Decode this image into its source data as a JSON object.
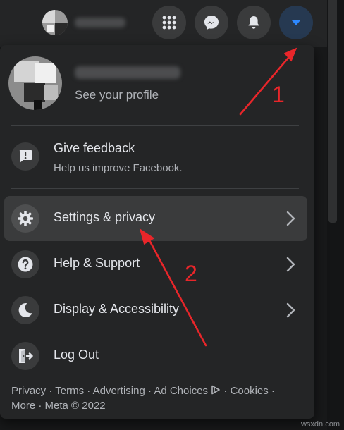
{
  "topbar": {
    "menu_icon": "grid-menu-icon",
    "messenger_icon": "messenger-icon",
    "notifications_icon": "bell-icon",
    "account_icon": "caret-down-icon",
    "accent_color": "#2d88ff"
  },
  "profile": {
    "see_profile": "See your profile"
  },
  "feedback": {
    "title": "Give feedback",
    "subtitle": "Help us improve Facebook.",
    "icon": "exclamation-comment-icon"
  },
  "menu": [
    {
      "label": "Settings & privacy",
      "icon": "gear-icon",
      "has_chevron": true
    },
    {
      "label": "Help & Support",
      "icon": "question-icon",
      "has_chevron": true
    },
    {
      "label": "Display & Accessibility",
      "icon": "moon-icon",
      "has_chevron": true
    },
    {
      "label": "Log Out",
      "icon": "logout-door-icon",
      "has_chevron": false
    }
  ],
  "footer": {
    "privacy": "Privacy",
    "terms": "Terms",
    "advertising": "Advertising",
    "ad_choices": "Ad Choices",
    "cookies": "Cookies",
    "more": "More",
    "meta": "Meta © 2022",
    "sep": " · "
  },
  "annotations": {
    "step1": "1",
    "step2": "2",
    "color": "#e8262a"
  },
  "watermark": "wsxdn.com"
}
